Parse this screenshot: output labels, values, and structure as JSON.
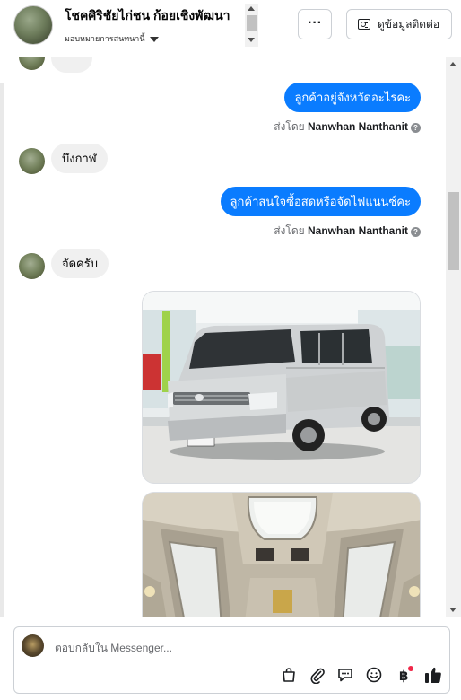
{
  "header": {
    "page_name": "โชคศิริชัยไก่ชน ก้อยเชิงพัฒนา",
    "assign_label": "มอบหมายการสนทนานี้",
    "more_label": "···",
    "contact_label": "ดูข้อมูลติดต่อ"
  },
  "messages": [
    {
      "side": "out",
      "text": "ลูกค้าอยู่จังหวัดอะไรคะ"
    },
    {
      "side": "meta",
      "prefix": "ส่งโดย",
      "name": "Nanwhan Nanthanit"
    },
    {
      "side": "in",
      "text": "บึงกาฬ"
    },
    {
      "side": "out",
      "text": "ลูกค้าสนใจซื้อสดหรือจัดไฟแนนซ์คะ"
    },
    {
      "side": "meta",
      "prefix": "ส่งโดย",
      "name": "Nanwhan Nanthanit"
    },
    {
      "side": "in",
      "text": "จัดครับ"
    }
  ],
  "composer": {
    "placeholder": "ตอบกลับใน Messenger...",
    "tools": [
      "shopping-bag-icon",
      "attachment-icon",
      "saved-replies-icon",
      "emoji-icon",
      "baht-payment-icon",
      "like-icon"
    ]
  },
  "colors": {
    "outgoing_bubble": "#0a7cff",
    "incoming_bubble": "#f0f0f0",
    "notification_dot": "#f02849"
  }
}
